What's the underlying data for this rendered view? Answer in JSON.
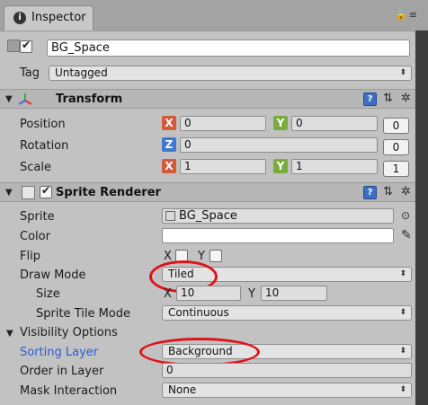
{
  "window": {
    "tab_title": "Inspector",
    "tab_actions": "🔒≡"
  },
  "gameobject": {
    "active": true,
    "name": "BG_Space",
    "tag_label": "Tag",
    "tag_value": "Untagged"
  },
  "transform": {
    "title": "Transform",
    "rows": [
      {
        "label": "Position",
        "x": "0",
        "y": "0",
        "third": "0"
      },
      {
        "label": "Rotation",
        "z": "0",
        "third": "0"
      },
      {
        "label": "Scale",
        "x": "1",
        "y": "1",
        "third": "1"
      }
    ]
  },
  "sprite_renderer": {
    "title": "Sprite Renderer",
    "enabled": true,
    "sprite_label": "Sprite",
    "sprite_value": "BG_Space",
    "color_label": "Color",
    "flip_label": "Flip",
    "flip_x_label": "X",
    "flip_y_label": "Y",
    "draw_mode_label": "Draw Mode",
    "draw_mode_value": "Tiled",
    "size_label": "Size",
    "size_x_label": "X",
    "size_x_value": "10",
    "size_y_label": "Y",
    "size_y_value": "10",
    "tile_mode_label": "Sprite Tile Mode",
    "tile_mode_value": "Continuous",
    "visibility_label": "Visibility Options",
    "sorting_layer_label": "Sorting Layer",
    "sorting_layer_value": "Background",
    "order_label": "Order in Layer",
    "order_value": "0",
    "mask_label": "Mask Interaction",
    "mask_value": "None"
  },
  "icons": {
    "help": "?",
    "preset": "⇅",
    "gear": "✲",
    "dropdown_arrow": "⬍",
    "target": "⊙",
    "eyedropper": "✎",
    "foldout_open": "▼",
    "foldout_open_small": "▼"
  },
  "colors": {
    "annotation_red": "#e01218",
    "axis_x": "#d35a3a",
    "axis_y": "#7aac3c",
    "axis_z": "#3f78d1",
    "highlight_blue": "#2a5bd7"
  }
}
